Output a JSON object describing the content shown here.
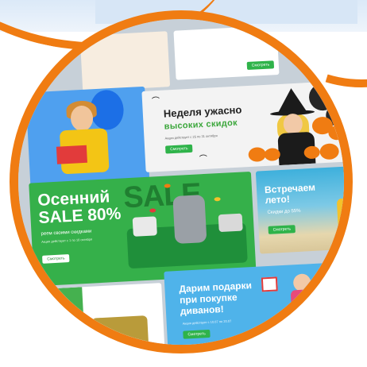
{
  "colors": {
    "accent": "#f07c12",
    "green": "#2fb34a"
  },
  "banners": {
    "halloween": {
      "title": "Неделя ужасно",
      "subtitle": "высоких скидок",
      "note": "Акция действует с 25 по 31 октября",
      "button": "Смотреть"
    },
    "autumn": {
      "title_line1": "Осенний",
      "title_line2": "SALE 80%",
      "big_word": "SALE",
      "subtitle": "реем своими скидками",
      "note": "Акция действует с 1 по 10 октября",
      "button": "Смотреть"
    },
    "summer": {
      "title_line1": "Встречаем",
      "title_line2": "лето!",
      "subtitle": "Скидки до 55%",
      "button": "Смотреть"
    },
    "gifts": {
      "title_line1": "Дарим подарки",
      "title_line2": "при покупке",
      "title_line3": "диванов!",
      "note": "Акция действует с 10.07 по 20.07",
      "button": "Смотреть"
    },
    "top_right": {
      "button": "Смотреть"
    }
  }
}
